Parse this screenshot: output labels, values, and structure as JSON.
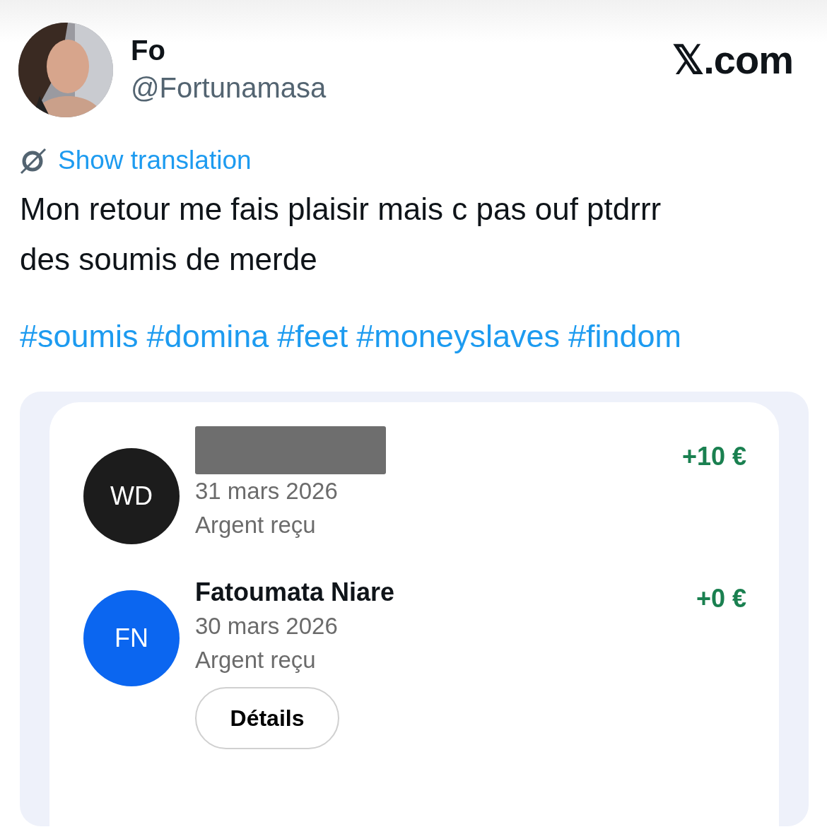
{
  "author": {
    "name": "Fo",
    "handle": "@Fortunamasa"
  },
  "site": "𝕏.com",
  "translation_link": "Show translation",
  "text_lines": [
    "Mon retour me fais plaisir mais c pas ouf ptdrrr",
    "des soumis de merde"
  ],
  "hashtags": [
    "#soumis",
    "#domina",
    "#feet",
    "#moneyslaves",
    "#findom"
  ],
  "transactions": [
    {
      "initials": "WD",
      "color": "#1c1c1c",
      "name_redacted": true,
      "date": "31 mars 2026",
      "status": "Argent reçu",
      "amount": "+10 €"
    },
    {
      "initials": "FN",
      "color": "#0b66f0",
      "name_redacted": false,
      "name": "Fatoumata Niare",
      "date": "30 mars 2026",
      "status": "Argent reçu",
      "amount": "+0 €",
      "button": "Détails"
    }
  ]
}
